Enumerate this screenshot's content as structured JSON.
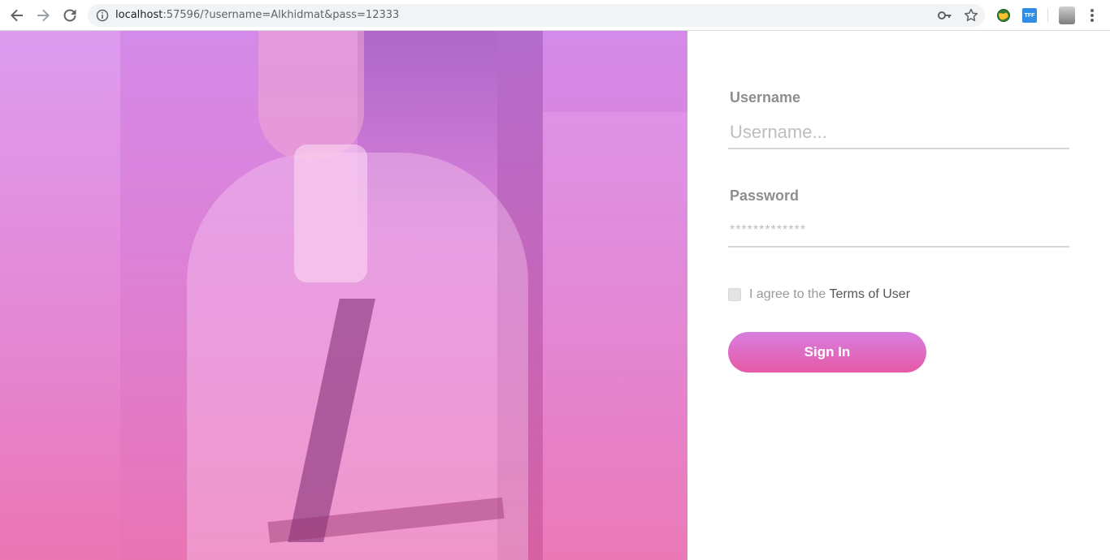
{
  "browser": {
    "url_host": "localhost",
    "url_rest": ":57596/?username=Alkhidmat&pass=12333",
    "extension_tff_label": "TFF"
  },
  "form": {
    "username_label": "Username",
    "username_placeholder": "Username...",
    "password_label": "Password",
    "password_placeholder": "*************",
    "agree_prefix": "I agree to the ",
    "terms_link": "Terms of User",
    "signin_label": "Sign In"
  },
  "colors": {
    "accent_gradient_top": "#d77ee0",
    "accent_gradient_bottom": "#e75aa5",
    "label_gray": "#8e8e8e"
  },
  "icons": [
    "back-arrow-icon",
    "forward-arrow-icon",
    "reload-icon",
    "info-icon",
    "key-icon",
    "star-icon",
    "globe-extension-icon",
    "tff-extension-icon",
    "profile-avatar",
    "menu-dots-icon"
  ]
}
